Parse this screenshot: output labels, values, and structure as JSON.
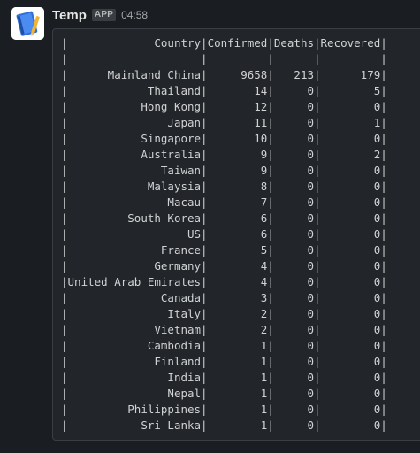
{
  "message": {
    "sender": "Temp",
    "badge": "APP",
    "time": "04:58",
    "avatar_icon": "notebook-icon"
  },
  "table": {
    "headers": [
      "Country",
      "Confirmed",
      "Deaths",
      "Recovered"
    ],
    "rows": [
      {
        "country": "Mainland China",
        "confirmed": "9658",
        "deaths": "213",
        "recovered": "179"
      },
      {
        "country": "Thailand",
        "confirmed": "14",
        "deaths": "0",
        "recovered": "5"
      },
      {
        "country": "Hong Kong",
        "confirmed": "12",
        "deaths": "0",
        "recovered": "0"
      },
      {
        "country": "Japan",
        "confirmed": "11",
        "deaths": "0",
        "recovered": "1"
      },
      {
        "country": "Singapore",
        "confirmed": "10",
        "deaths": "0",
        "recovered": "0"
      },
      {
        "country": "Australia",
        "confirmed": "9",
        "deaths": "0",
        "recovered": "2"
      },
      {
        "country": "Taiwan",
        "confirmed": "9",
        "deaths": "0",
        "recovered": "0"
      },
      {
        "country": "Malaysia",
        "confirmed": "8",
        "deaths": "0",
        "recovered": "0"
      },
      {
        "country": "Macau",
        "confirmed": "7",
        "deaths": "0",
        "recovered": "0"
      },
      {
        "country": "South Korea",
        "confirmed": "6",
        "deaths": "0",
        "recovered": "0"
      },
      {
        "country": "US",
        "confirmed": "6",
        "deaths": "0",
        "recovered": "0"
      },
      {
        "country": "France",
        "confirmed": "5",
        "deaths": "0",
        "recovered": "0"
      },
      {
        "country": "Germany",
        "confirmed": "4",
        "deaths": "0",
        "recovered": "0"
      },
      {
        "country": "United Arab Emirates",
        "confirmed": "4",
        "deaths": "0",
        "recovered": "0"
      },
      {
        "country": "Canada",
        "confirmed": "3",
        "deaths": "0",
        "recovered": "0"
      },
      {
        "country": "Italy",
        "confirmed": "2",
        "deaths": "0",
        "recovered": "0"
      },
      {
        "country": "Vietnam",
        "confirmed": "2",
        "deaths": "0",
        "recovered": "0"
      },
      {
        "country": "Cambodia",
        "confirmed": "1",
        "deaths": "0",
        "recovered": "0"
      },
      {
        "country": "Finland",
        "confirmed": "1",
        "deaths": "0",
        "recovered": "0"
      },
      {
        "country": "India",
        "confirmed": "1",
        "deaths": "0",
        "recovered": "0"
      },
      {
        "country": "Nepal",
        "confirmed": "1",
        "deaths": "0",
        "recovered": "0"
      },
      {
        "country": "Philippines",
        "confirmed": "1",
        "deaths": "0",
        "recovered": "0"
      },
      {
        "country": "Sri Lanka",
        "confirmed": "1",
        "deaths": "0",
        "recovered": "0"
      }
    ]
  }
}
